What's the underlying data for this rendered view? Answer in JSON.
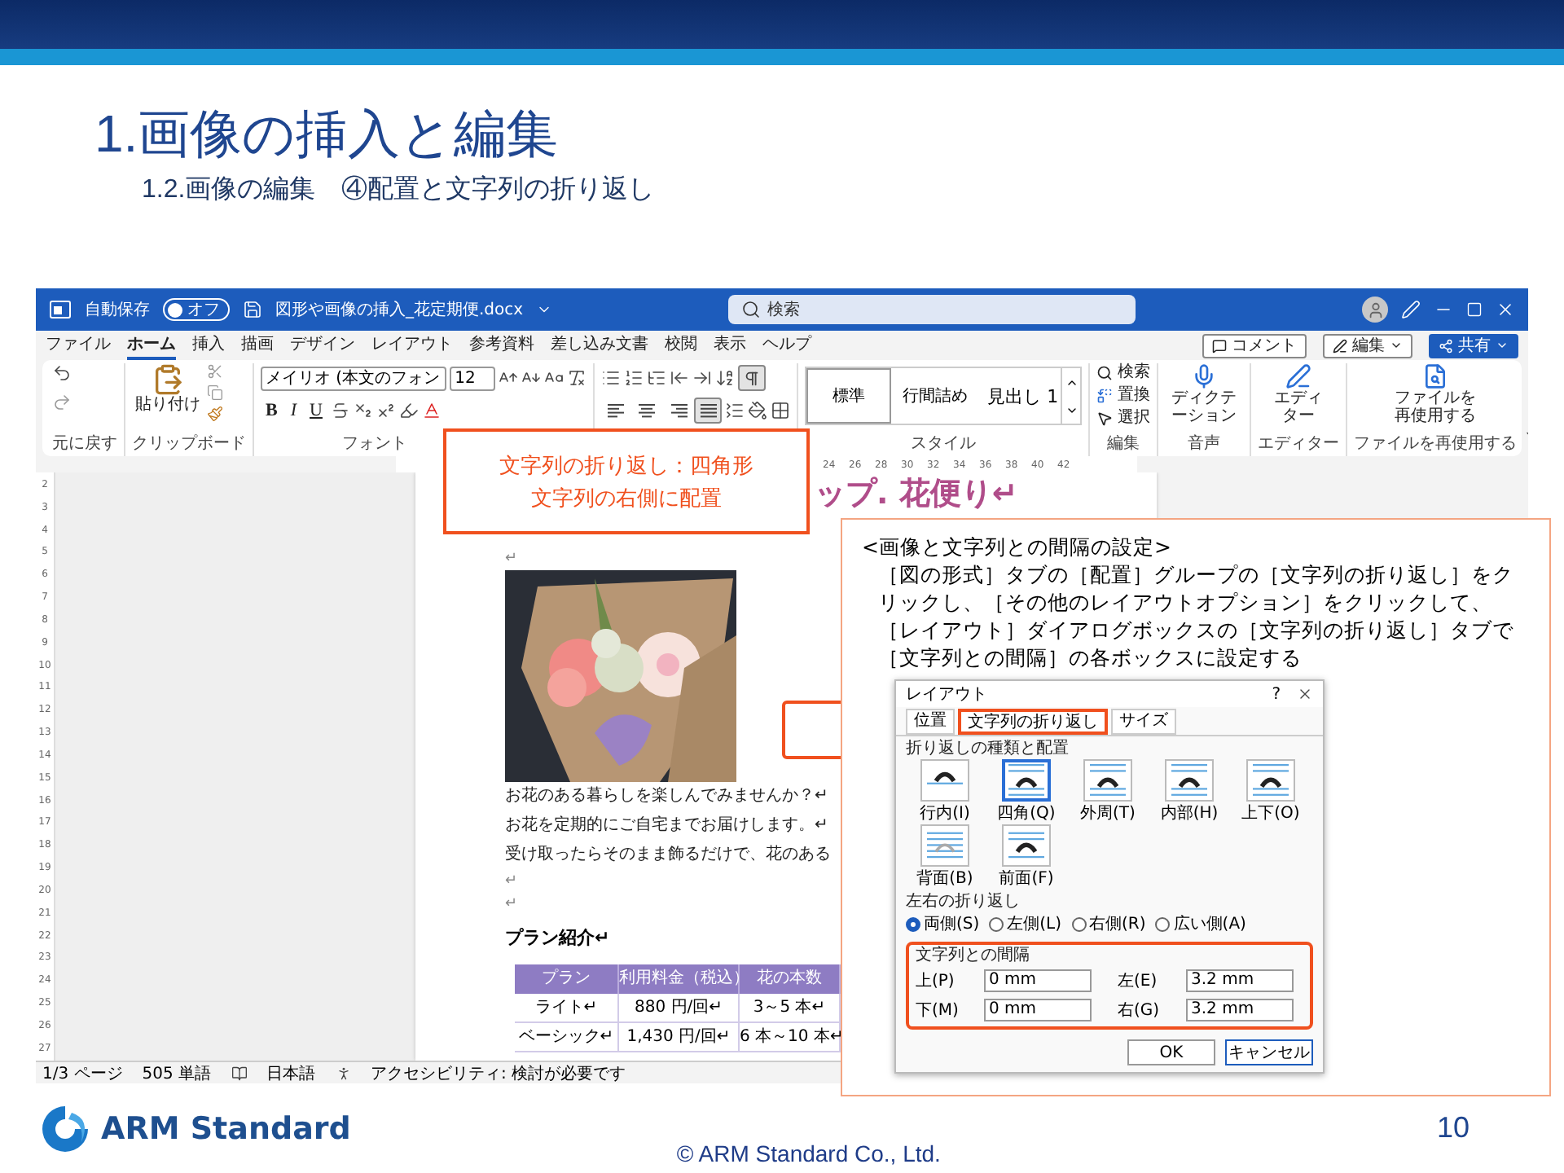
{
  "slide": {
    "title": "1.画像の挿入と編集",
    "subtitle": "1.2.画像の編集　④配置と文字列の折り返し",
    "logo_text": "ARM Standard",
    "copyright": "© ARM Standard Co., Ltd.",
    "page_number": "10"
  },
  "word_window": {
    "autosave_label": "自動保存",
    "autosave": {
      "on": false,
      "label": "オフ"
    },
    "filename": "図形や画像の挿入_花定期便.docx",
    "search": {
      "placeholder": "検索"
    },
    "menu_tabs": [
      {
        "label": "ファイル",
        "selected": false
      },
      {
        "label": "ホーム",
        "selected": true
      },
      {
        "label": "挿入",
        "selected": false
      },
      {
        "label": "描画",
        "selected": false
      },
      {
        "label": "デザイン",
        "selected": false
      },
      {
        "label": "レイアウト",
        "selected": false
      },
      {
        "label": "参考資料",
        "selected": false
      },
      {
        "label": "差し込み文書",
        "selected": false
      },
      {
        "label": "校閲",
        "selected": false
      },
      {
        "label": "表示",
        "selected": false
      },
      {
        "label": "ヘルプ",
        "selected": false
      }
    ],
    "header_buttons": [
      "コメント",
      "編集",
      "共有"
    ],
    "ribbon": {
      "undo_label": "元に戻す",
      "paste": "貼り付け",
      "clipboard_label": "クリップボード",
      "font_name": "メイリオ (本文のフォン",
      "font_size": "12",
      "format_letters": [
        "B",
        "I",
        "U"
      ],
      "font_label": "フォント",
      "show_marks": {
        "on": true
      },
      "alignment": [
        {
          "selected": false
        },
        {
          "selected": false
        },
        {
          "selected": false
        },
        {
          "selected": true
        }
      ],
      "styles": [
        {
          "label": "標準",
          "selected": true
        },
        {
          "label": "行間詰め",
          "selected": false
        },
        {
          "label": "見出し 1",
          "selected": false
        }
      ],
      "styles_label": "スタイル",
      "editing": [
        "検索",
        "置換",
        "選択"
      ],
      "editing_label": "編集",
      "dictation": "ディクテーション",
      "voice_label": "音声",
      "editor": "エディター",
      "editor_label": "エディター",
      "reuse": "ファイルを再使用する",
      "reuse_label": "ファイルを再使用する"
    },
    "ruler_numbers": [
      "24",
      "26",
      "28",
      "30",
      "32",
      "34",
      "36",
      "38",
      "40",
      "42"
    ],
    "vertical_ruler": [
      "2",
      "3",
      "4",
      "5",
      "6",
      "7",
      "8",
      "9",
      "10",
      "11",
      "12",
      "13",
      "14",
      "15",
      "16",
      "17",
      "18",
      "19",
      "20",
      "21",
      "22",
      "23",
      "24",
      "25",
      "26",
      "27"
    ],
    "document": {
      "heading": "ップ. 花便り↵",
      "top_mark": "↵",
      "lines": [
        "お花のある暮らしを楽しんでみませんか？↵",
        "お花を定期的にご自宅までお届けします。↵",
        "受け取ったらそのまま飾るだけで、花のある",
        "↵",
        "↵"
      ],
      "section_title": "プラン紹介↵",
      "table": {
        "columns": [
          "プラン",
          "利用料金（税込）",
          "花の本数"
        ],
        "rows": [
          [
            "ライト↵",
            "880 円/回↵",
            "3～5 本↵"
          ],
          [
            "ベーシック↵",
            "1,430 円/回↵",
            "6 本～10 本↵"
          ]
        ]
      }
    },
    "status_bar": [
      "1/3 ページ",
      "505 単語",
      "日本語",
      "アクセシビリティ: 検討が必要です"
    ]
  },
  "callout": {
    "lines": [
      "文字列の折り返し：四角形",
      "文字列の右側に配置"
    ]
  },
  "explanation": {
    "heading": "<画像と文字列との間隔の設定>",
    "body": "［図の形式］タブの［配置］グループの［文字列の折り返し］をクリックし、［その他のレイアウトオプション］をクリックして、［レイアウト］ダイアログボックスの［文字列の折り返し］タブで［文字列との間隔］の各ボックスに設定する"
  },
  "layout_dialog": {
    "title": "レイアウト",
    "help": "?",
    "tabs": [
      {
        "label": "位置",
        "selected": false
      },
      {
        "label": "文字列の折り返し",
        "selected": true
      },
      {
        "label": "サイズ",
        "selected": false
      }
    ],
    "wrap_group": "折り返しの種類と配置",
    "wrap_options": [
      {
        "label": "行内(I)",
        "kind": "inline",
        "selected": false
      },
      {
        "label": "四角(Q)",
        "kind": "square",
        "selected": true
      },
      {
        "label": "外周(T)",
        "kind": "tight",
        "selected": false
      },
      {
        "label": "内部(H)",
        "kind": "through",
        "selected": false
      },
      {
        "label": "上下(O)",
        "kind": "topbottom",
        "selected": false
      },
      {
        "label": "背面(B)",
        "kind": "behind",
        "selected": false
      },
      {
        "label": "前面(F)",
        "kind": "front",
        "selected": false
      }
    ],
    "sides_group": "左右の折り返し",
    "sides": [
      {
        "label": "両側(S)",
        "selected": true
      },
      {
        "label": "左側(L)",
        "selected": false
      },
      {
        "label": "右側(R)",
        "selected": false
      },
      {
        "label": "広い側(A)",
        "selected": false
      }
    ],
    "spacing_group": "文字列との間隔",
    "spacing": [
      {
        "label": "上(P)",
        "value": "0 mm"
      },
      {
        "label": "左(E)",
        "value": "3.2 mm"
      },
      {
        "label": "下(M)",
        "value": "0 mm"
      },
      {
        "label": "右(G)",
        "value": "3.2 mm"
      }
    ],
    "buttons": [
      "OK",
      "キャンセル"
    ]
  }
}
